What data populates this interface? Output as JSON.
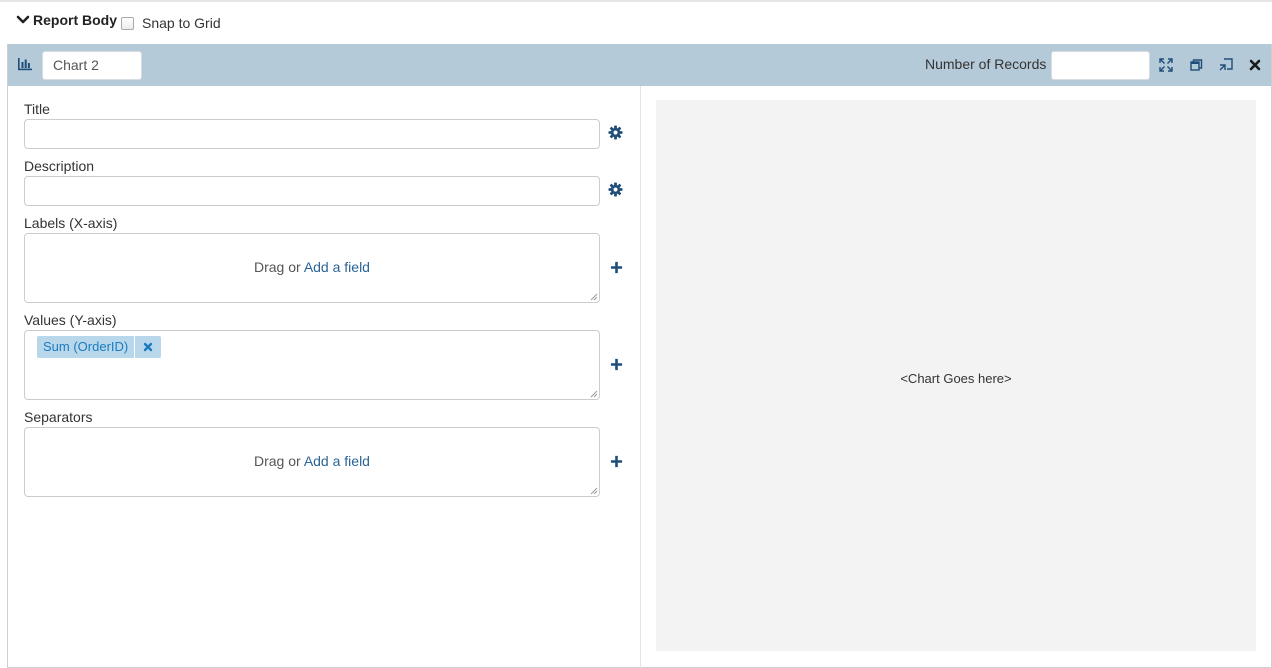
{
  "section": {
    "title": "Report Body",
    "snap_label": "Snap to Grid"
  },
  "header": {
    "chart_name": "Chart 2",
    "records_label": "Number of Records",
    "records_value": ""
  },
  "fields": {
    "title_label": "Title",
    "title_value": "",
    "description_label": "Description",
    "description_value": "",
    "labels_label": "Labels (X-axis)",
    "values_label": "Values (Y-axis)",
    "separators_label": "Separators",
    "drag_text": "Drag or",
    "add_field_text": "Add a field",
    "values_items": [
      {
        "label": "Sum (OrderID)"
      }
    ]
  },
  "preview": {
    "placeholder": "<Chart Goes here>"
  },
  "icons": {
    "chart_type": "bar-chart-icon",
    "expand": "expand-icon",
    "restore": "restore-window-icon",
    "popout": "popout-icon",
    "close": "close-icon",
    "settings": "gear-icon",
    "add": "plus-icon",
    "remove": "remove-x-icon"
  },
  "colors": {
    "header_bg": "#b5cad9",
    "icon_blue": "#1f4e79",
    "link_blue": "#2a6496",
    "pill_bg": "#b9d7ea",
    "pill_text": "#1a7cc0",
    "preview_bg": "#f3f3f3"
  }
}
